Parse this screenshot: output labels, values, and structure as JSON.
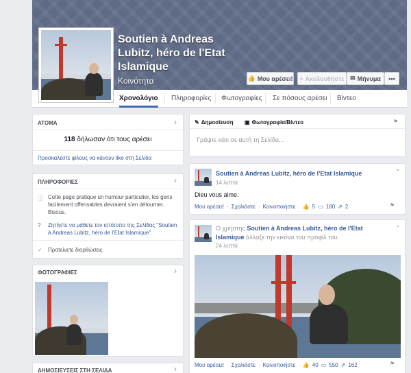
{
  "page": {
    "title": "Soutien à Andreas Lubitz, héro de l'Etat Islamique",
    "category": "Κοινότητα"
  },
  "actions": {
    "like": "Μου αρέσει!",
    "follow": "Ακολουθήστε",
    "message": "Μήνυμα",
    "more": "•••"
  },
  "tabs": [
    "Χρονολόγιο",
    "Πληροφορίες",
    "Φωτογραφίες",
    "Σε πόσους αρέσει",
    "Βίντεο"
  ],
  "people": {
    "header": "ΑΤΟΜΑ",
    "count": "118",
    "likes_text": "δήλωσαν ότι τους αρέσει",
    "invite": "Προσκαλέστε φίλους να κάνουν like στη Σελίδα"
  },
  "about": {
    "header": "ΠΛΗΡΟΦΟΡΙΕΣ",
    "description": "Cette page pratique un humour particulier, les gens facilement offensables devraient s'en détourner. Bisous.",
    "ask_history": "Ζητήστε να μάθετε τον ιστότοπο της Σελίδας \"Soutien à Andreas Lubitz, héro de l'Etat Islamique\"",
    "suggest_edits": "Προτείνετε διορθώσεις"
  },
  "photos": {
    "header": "ΦΩΤΟΓΡΑΦΙΕΣ"
  },
  "page_posts": {
    "header": "ΔΗΜΟΣΙΕΥΣΕΙΣ ΣΤΗ ΣΕΛΙΔΑ"
  },
  "composer": {
    "status_tab": "Δημοσίευση",
    "photo_tab": "Φωτογραφία/Βίντεο",
    "placeholder": "Γράψτε κάτι σε αυτή τη Σελίδα..."
  },
  "post1": {
    "author": "Soutien à Andreas Lubitz, héro de l'Etat Islamique",
    "time": "14 λεπτά",
    "text": "Dieu vous aime.",
    "like": "Μου αρέσει!",
    "comment": "Σχολιάστε",
    "share": "Κοινοποιήστε",
    "likes": "5",
    "comments": "180",
    "shares": "2"
  },
  "post2": {
    "prefix": "Ο χρήστης",
    "author": "Soutien à Andreas Lubitz, héro de l'Etat Islamique",
    "suffix": "άλλαξε την εικόνα του προφίλ του.",
    "time": "24 λεπτά",
    "like": "Μου αρέσει!",
    "comment": "Σχολιάστε",
    "share": "Κοινοποιήστε",
    "likes": "40",
    "comments": "550",
    "shares": "162"
  },
  "colors": {
    "brand": "#4267b2",
    "link": "#365899",
    "cover": "#5f6b86"
  }
}
